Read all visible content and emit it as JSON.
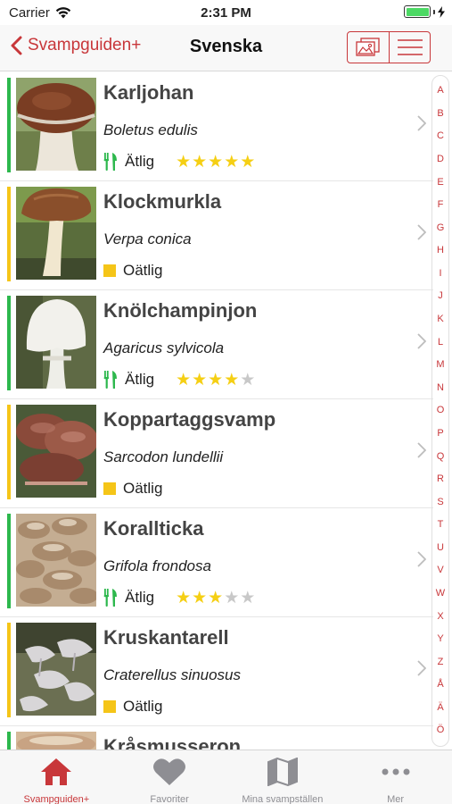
{
  "status": {
    "carrier": "Carrier",
    "time": "2:31 PM"
  },
  "nav": {
    "back_label": "Svampguiden+",
    "title": "Svenska"
  },
  "colors": {
    "accent": "#c8373a",
    "edible": "#2db84d",
    "inedible": "#f5c518",
    "star": "#f5cf14"
  },
  "items": [
    {
      "name": "Karljohan",
      "latin": "Boletus edulis",
      "edibility": "Ätlig",
      "edible": true,
      "rating": 5,
      "thumb": "porcini"
    },
    {
      "name": "Klockmurkla",
      "latin": "Verpa conica",
      "edibility": "Oätlig",
      "edible": false,
      "rating": 0,
      "thumb": "verpa"
    },
    {
      "name": "Knölchampinjon",
      "latin": "Agaricus sylvicola",
      "edibility": "Ätlig",
      "edible": true,
      "rating": 4,
      "thumb": "agaricus"
    },
    {
      "name": "Koppartaggsvamp",
      "latin": "Sarcodon lundellii",
      "edibility": "Oätlig",
      "edible": false,
      "rating": 0,
      "thumb": "sarcodon"
    },
    {
      "name": "Korallticka",
      "latin": "Grifola frondosa",
      "edibility": "Ätlig",
      "edible": true,
      "rating": 3,
      "thumb": "grifola"
    },
    {
      "name": "Kruskantarell",
      "latin": "Craterellus sinuosus",
      "edibility": "Oätlig",
      "edible": false,
      "rating": 0,
      "thumb": "craterellus"
    },
    {
      "name": "Kråsmusseron",
      "latin": "",
      "edibility": "",
      "edible": true,
      "rating": 0,
      "thumb": "partial"
    }
  ],
  "index": [
    "A",
    "B",
    "C",
    "D",
    "E",
    "F",
    "G",
    "H",
    "I",
    "J",
    "K",
    "L",
    "M",
    "N",
    "O",
    "P",
    "Q",
    "R",
    "S",
    "T",
    "U",
    "V",
    "W",
    "X",
    "Y",
    "Z",
    "Å",
    "Ä",
    "Ö"
  ],
  "tabs": [
    {
      "label": "Svampguiden+",
      "icon": "home-icon",
      "active": true
    },
    {
      "label": "Favoriter",
      "icon": "heart-icon",
      "active": false
    },
    {
      "label": "Mina svampställen",
      "icon": "map-icon",
      "active": false
    },
    {
      "label": "Mer",
      "icon": "more-icon",
      "active": false
    }
  ]
}
